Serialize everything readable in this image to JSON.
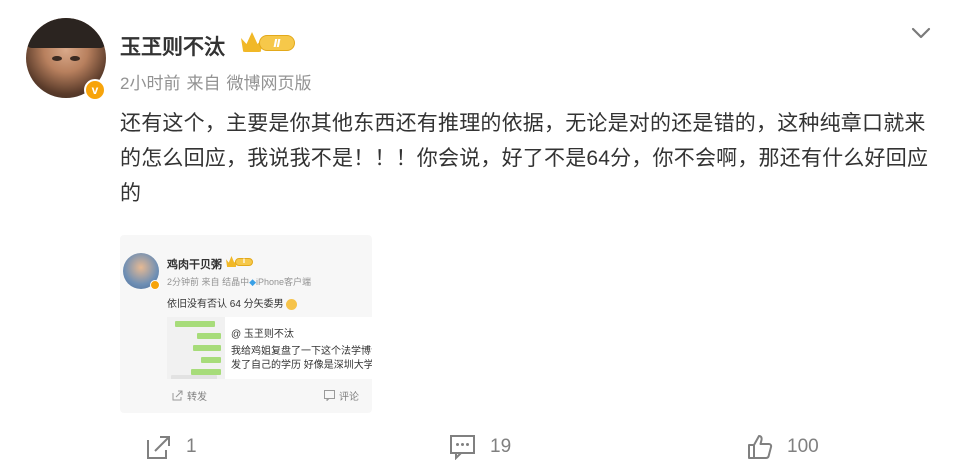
{
  "post": {
    "username": "玉玊则不汰",
    "rank_label": "Ⅱ",
    "time": "2小时前",
    "source_prefix": "来自",
    "source": "微博网页版",
    "avatar_badge": "v",
    "content": "还有这个，主要是你其他东西还有推理的依据，无论是对的还是错的，这种纯章口就来的怎么回应，我说我不是！！！你会说，好了不是64分，你不会啊，那还有什么好回应的"
  },
  "embedded_card": {
    "username": "鸡肉干贝粥",
    "rank_label": "Ⅰ",
    "time": "2分钟前",
    "source_prefix": "来自",
    "source_mid": "结晶中",
    "source": "iPhone客户端",
    "text": "依旧没有否认 64 分矢委男",
    "quoted_at": "@ 玉玊则不汰",
    "quoted_line1": "我给鸡姐复盘了一下这个法学博士",
    "quoted_line2": "发了自己的学历 好像是深圳大学的",
    "action_repost": "转发",
    "action_comment": "评论"
  },
  "actions": {
    "repost_count": "1",
    "comment_count": "19",
    "like_count": "100"
  },
  "icons": {
    "collapse": "chevron-down-icon",
    "repost": "share-icon",
    "comment": "comment-icon",
    "like": "thumbs-up-icon"
  },
  "colors": {
    "accent_orange": "#f7a40b",
    "meta_gray": "#939393",
    "text": "#333333"
  }
}
